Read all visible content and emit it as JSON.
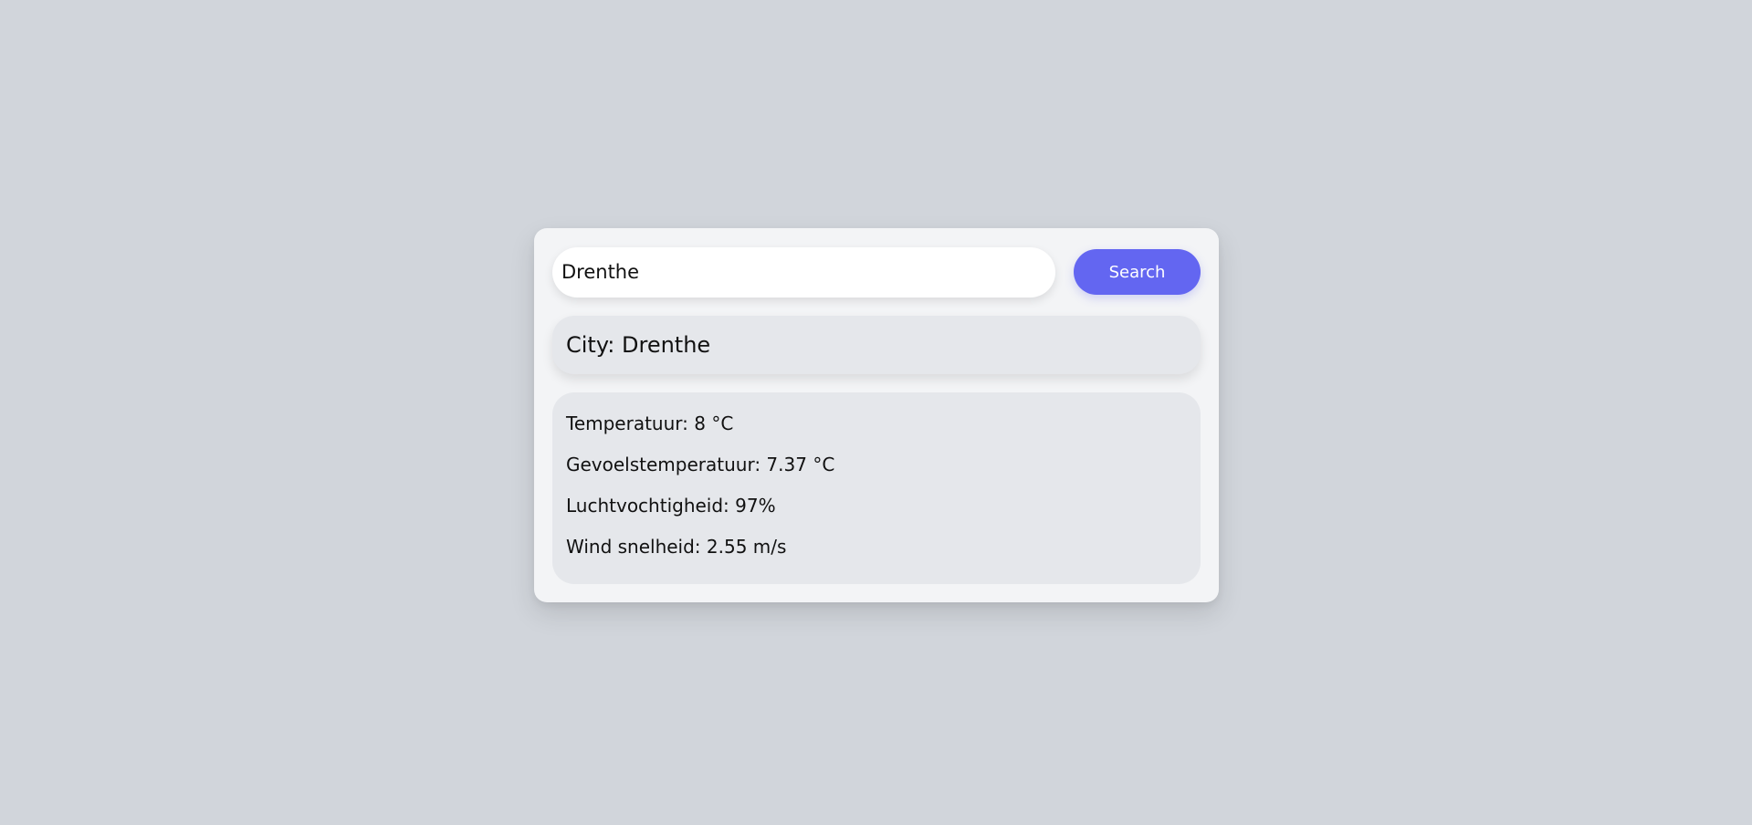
{
  "search": {
    "value": "Drenthe",
    "button_label": "Search"
  },
  "city": {
    "text": "City: Drenthe"
  },
  "weather": {
    "temperature": "Temperatuur: 8 °C",
    "feels_like": "Gevoelstemperatuur: 7.37 °C",
    "humidity": "Luchtvochtigheid: 97%",
    "wind_speed": "Wind snelheid: 2.55 m/s"
  },
  "colors": {
    "background": "#d1d5db",
    "card": "#f3f4f6",
    "panel": "#e5e7eb",
    "accent": "#6366f1"
  }
}
